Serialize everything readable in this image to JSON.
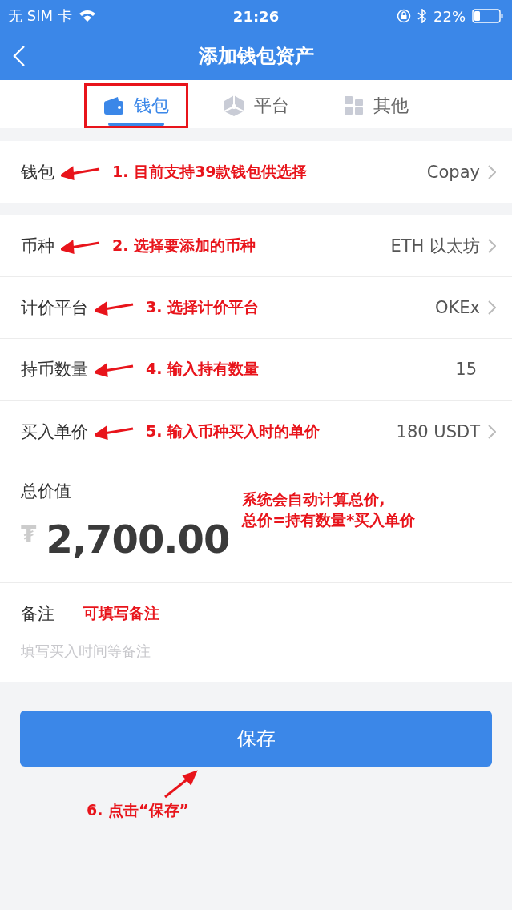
{
  "status_bar": {
    "carrier": "无 SIM 卡",
    "time": "21:26",
    "battery": "22%"
  },
  "nav": {
    "title": "添加钱包资产"
  },
  "tabs": [
    {
      "label": "钱包",
      "kind": "wallet",
      "selected": true,
      "annotated": true
    },
    {
      "label": "平台",
      "kind": "cube",
      "selected": false,
      "annotated": false
    },
    {
      "label": "其他",
      "kind": "grid",
      "selected": false,
      "annotated": false
    }
  ],
  "groups": [
    {
      "rows": [
        {
          "label": "钱包",
          "annotation": "1. 目前支持39款钱包供选择",
          "value": "Copay",
          "chevron": true
        }
      ]
    },
    {
      "rows": [
        {
          "label": "币种",
          "annotation": "2. 选择要添加的币种",
          "value": "ETH 以太坊",
          "chevron": true
        },
        {
          "label": "计价平台",
          "annotation": "3. 选择计价平台",
          "value": "OKEx",
          "chevron": true
        },
        {
          "label": "持币数量",
          "annotation": "4. 输入持有数量",
          "value": "15",
          "chevron": false
        },
        {
          "label": "买入单价",
          "annotation": "5. 输入币种买入时的单价",
          "value": "180 USDT",
          "chevron": true
        }
      ]
    }
  ],
  "total": {
    "label": "总价值",
    "currency": "₮",
    "amount": "2,700.00",
    "annotation": [
      "系统会自动计算总价,",
      "总价=持有数量*买入单价"
    ]
  },
  "note": {
    "label": "备注",
    "annotation": "可填写备注",
    "placeholder": "填写买入时间等备注"
  },
  "save_button": {
    "label": "保存",
    "annotation": "6. 点击“保存”"
  }
}
